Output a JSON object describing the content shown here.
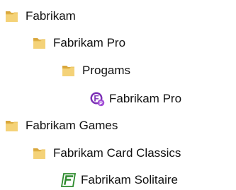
{
  "tree": {
    "items": [
      {
        "label": "Fabrikam",
        "icon": "folder-icon"
      },
      {
        "label": "Fabrikam Pro",
        "icon": "folder-icon"
      },
      {
        "label": "Progams",
        "icon": "folder-icon"
      },
      {
        "label": "Fabrikam Pro",
        "icon": "fabrikam-pro-app-icon"
      },
      {
        "label": "Fabrikam Games",
        "icon": "folder-icon"
      },
      {
        "label": "Fabrikam Card Classics",
        "icon": "folder-icon"
      },
      {
        "label": "Fabrikam Solitaire",
        "icon": "fabrikam-solitaire-app-icon"
      }
    ]
  },
  "colors": {
    "folder_back": "#d9a73c",
    "folder_front": "#f4d278",
    "pro_icon_purple": "#7b2fb5",
    "solitaire_icon_green": "#2e8b2e"
  }
}
